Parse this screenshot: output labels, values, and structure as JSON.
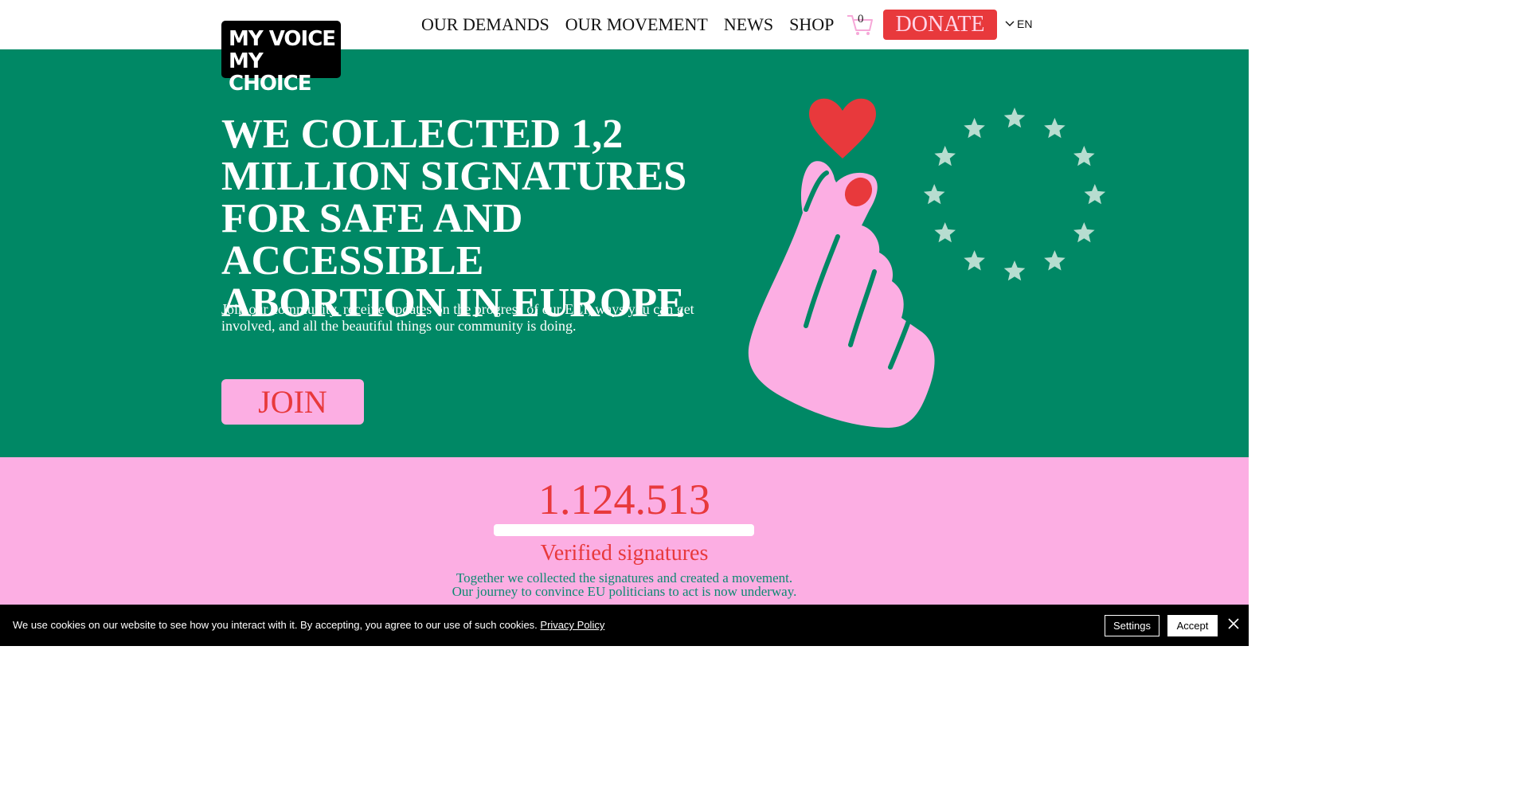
{
  "header": {
    "logo_line1": "MY VOICE",
    "logo_line2": "MY CHOICE",
    "nav": [
      "OUR DEMANDS",
      "OUR MOVEMENT",
      "NEWS",
      "SHOP"
    ],
    "cart_count": "0",
    "cart_icon": "cart-icon",
    "donate_label": "DONATE",
    "language": "EN"
  },
  "hero": {
    "title": "WE COLLECTED 1,2 MILLION SIGNATURES FOR SAFE AND ACCESSIBLE ABORTION IN EUROPE",
    "subtitle": "Join our community, receive updates on the progress of our ECI, ways you can get involved, and all the beautiful things our community is doing.",
    "join_label": "JOIN"
  },
  "counter": {
    "value": "1.124.513",
    "progress_fraction": 1.0,
    "label": "Verified signatures",
    "line1": "Together we collected the signatures and created a movement.",
    "line2": "Our journey to convince EU politicians to act is now underway."
  },
  "cookie": {
    "text": "We use cookies on our website to see how you interact with it. By accepting, you agree to our use of such cookies.",
    "policy_link": "Privacy Policy",
    "settings_label": "Settings",
    "accept_label": "Accept"
  },
  "colors": {
    "green": "#008865",
    "pink": "#fcaee3",
    "red": "#e8393c",
    "star": "#b7ddd0"
  }
}
